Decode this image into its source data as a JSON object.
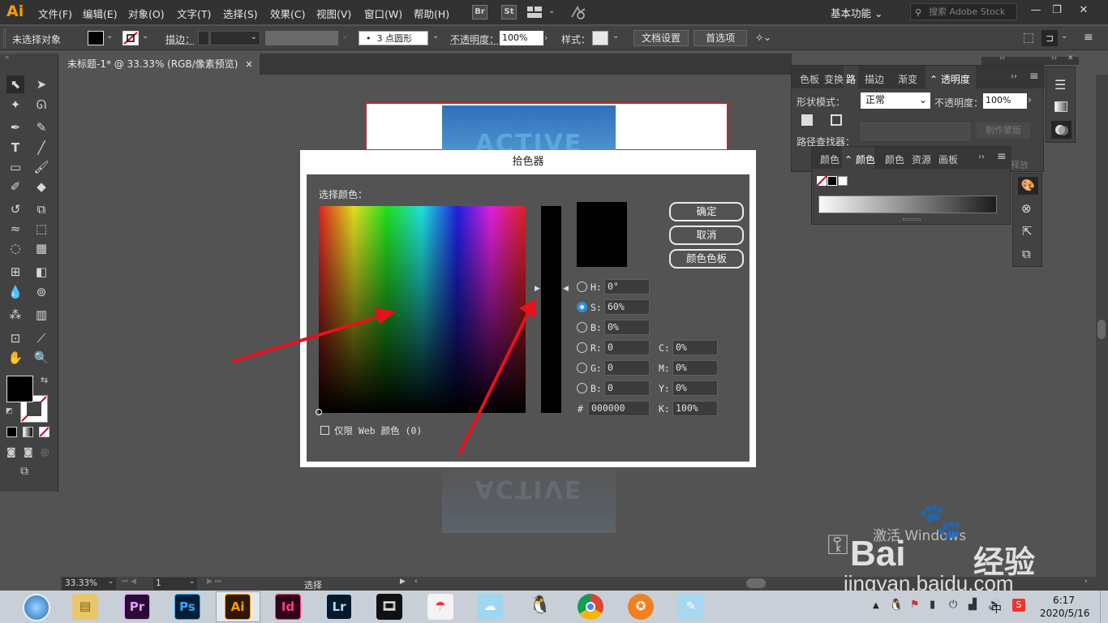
{
  "app": {
    "logo": "Ai",
    "menus": [
      "文件(F)",
      "编辑(E)",
      "对象(O)",
      "文字(T)",
      "选择(S)",
      "效果(C)",
      "视图(V)",
      "窗口(W)",
      "帮助(H)"
    ],
    "bridge_buttons": [
      "Br",
      "St"
    ],
    "workspace_label": "基本功能",
    "search_placeholder": "搜索 Adobe Stock"
  },
  "control_bar": {
    "no_selection": "未选择对象",
    "stroke_label": "描边：",
    "brush_label": "3 点圆形",
    "opacity_label": "不透明度：",
    "opacity_value": "100%",
    "style_label": "样式：",
    "doc_settings": "文档设置",
    "preferences": "首选项"
  },
  "document": {
    "tab_title": "未标题-1* @ 33.33% (RGB/像素预览)",
    "tab_close": "×",
    "art_text": "ACTIVE GIRL"
  },
  "color_picker": {
    "title": "拾色器",
    "select_color_label": "选择颜色：",
    "ok": "确定",
    "cancel": "取消",
    "swatches": "颜色色板",
    "web_only_label": "仅限 Web 颜色 (0)",
    "current_color": "#000000",
    "fields": {
      "H": "0°",
      "S": "60%",
      "B1": "0%",
      "R": "0",
      "G": "0",
      "B2": "0",
      "hex": "000000",
      "C": "0%",
      "M": "0%",
      "Y": "0%",
      "K": "100%"
    },
    "labels": {
      "H": "H:",
      "S": "S:",
      "B1": "B:",
      "R": "R:",
      "G": "G:",
      "B2": "B:",
      "hash": "#",
      "C": "C:",
      "M": "M:",
      "Y": "Y:",
      "K": "K:"
    },
    "selected_channel": "S"
  },
  "panels": {
    "transparency": {
      "tabs": [
        "色板",
        "变换",
        "路",
        "描边",
        "渐变",
        "透明度"
      ],
      "shape_mode": "形状模式：",
      "pathfinder": "路径查找器：",
      "blend_mode": "正常",
      "opacity_label": "不透明度：",
      "opacity_value": "100%",
      "make_mask": "制作蒙版",
      "release": "释放"
    },
    "color": {
      "tabs": [
        "颜色",
        "颜色",
        "颜色",
        "资源",
        "画板"
      ]
    }
  },
  "status_bar": {
    "zoom": "33.33%",
    "artboard": "1",
    "tool": "选择"
  },
  "watermark": {
    "activate_windows": "激活 Windows",
    "brand": "Bai",
    "brand2": "经验",
    "url": "jingyan.baidu.com"
  },
  "taskbar": {
    "apps": [
      "Pr",
      "Ps",
      "Ai",
      "Id",
      "Lr"
    ],
    "time": "6:17",
    "date": "2020/5/16",
    "ime": "中"
  }
}
